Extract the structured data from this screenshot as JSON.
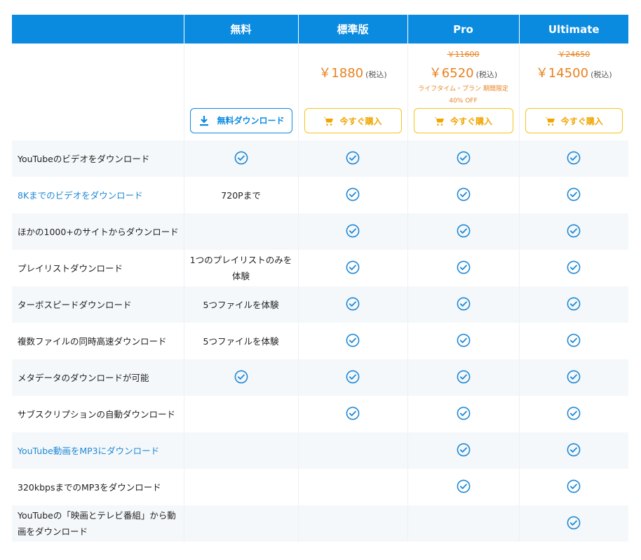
{
  "header": {
    "columns": [
      "",
      "無料",
      "標準版",
      "Pro",
      "Ultimate"
    ]
  },
  "pricing": {
    "free": {
      "button_label": "無料ダウンロード"
    },
    "standard": {
      "price": "￥1880",
      "tax_note": "(税込)",
      "button_label": "今すぐ購入"
    },
    "pro": {
      "original_price": "￥11600",
      "price": "￥6520",
      "tax_note": "(税込)",
      "promo_line1": "ライフタイム・プラン 期間限定",
      "promo_line2": "40% OFF",
      "button_label": "今すぐ購入"
    },
    "ultimate": {
      "original_price": "￥24650",
      "price": "￥14500",
      "tax_note": "(税込)",
      "button_label": "今すぐ購入"
    }
  },
  "features": [
    {
      "label": "YouTubeのビデオをダウンロード",
      "link": false,
      "free": "check",
      "standard": "check",
      "pro": "check",
      "ultimate": "check"
    },
    {
      "label": "8Kまでのビデオをダウンロード",
      "link": true,
      "free": "720Pまで",
      "standard": "check",
      "pro": "check",
      "ultimate": "check"
    },
    {
      "label": "ほかの1000+のサイトからダウンロード",
      "link": false,
      "free": "",
      "standard": "check",
      "pro": "check",
      "ultimate": "check"
    },
    {
      "label": "プレイリストダウンロード",
      "link": false,
      "free": "1つのプレイリストのみを体験",
      "standard": "check",
      "pro": "check",
      "ultimate": "check"
    },
    {
      "label": "ターボスピードダウンロード",
      "link": false,
      "free": "5つファイルを体験",
      "standard": "check",
      "pro": "check",
      "ultimate": "check"
    },
    {
      "label": "複数ファイルの同時高速ダウンロード",
      "link": false,
      "free": "5つファイルを体験",
      "standard": "check",
      "pro": "check",
      "ultimate": "check"
    },
    {
      "label": "メタデータのダウンロードが可能",
      "link": false,
      "free": "check",
      "standard": "check",
      "pro": "check",
      "ultimate": "check"
    },
    {
      "label": "サブスクリプションの自動ダウンロード",
      "link": false,
      "free": "",
      "standard": "check",
      "pro": "check",
      "ultimate": "check"
    },
    {
      "label": "YouTube動画をMP3にダウンロード",
      "link": true,
      "free": "",
      "standard": "",
      "pro": "check",
      "ultimate": "check"
    },
    {
      "label": "320kbpsまでのMP3をダウンロード",
      "link": false,
      "free": "",
      "standard": "",
      "pro": "check",
      "ultimate": "check"
    },
    {
      "label": "YouTubeの「映画とテレビ番組」から動画をダウンロード",
      "link": false,
      "free": "",
      "standard": "",
      "pro": "",
      "ultimate": "check"
    }
  ],
  "icons": {
    "check": "check-circle-icon",
    "download": "download-icon",
    "cart": "cart-icon"
  },
  "colors": {
    "header_bg": "#0b8be0",
    "accent_blue": "#1e88d6",
    "price_orange": "#e8821f",
    "buy_yellow": "#f5c518",
    "row_alt": "#f5f8fa"
  }
}
